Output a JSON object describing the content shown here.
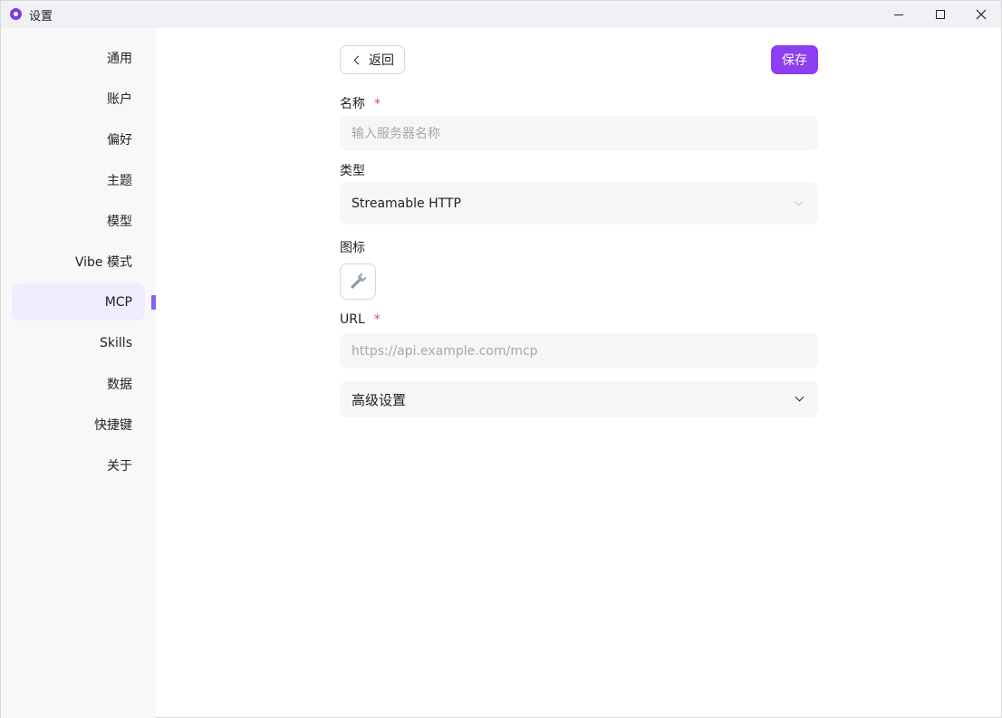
{
  "window": {
    "title": "设置",
    "minimize_icon": "minimize-icon",
    "maximize_icon": "maximize-icon",
    "close_icon": "close-icon"
  },
  "sidebar": {
    "items": [
      {
        "label": "通用"
      },
      {
        "label": "账户"
      },
      {
        "label": "偏好"
      },
      {
        "label": "主题"
      },
      {
        "label": "模型"
      },
      {
        "label": "Vibe 模式"
      },
      {
        "label": "MCP",
        "active": true
      },
      {
        "label": "Skills"
      },
      {
        "label": "数据"
      },
      {
        "label": "快捷键"
      },
      {
        "label": "关于"
      }
    ]
  },
  "toolbar": {
    "back_label": "返回",
    "save_label": "保存"
  },
  "form": {
    "name": {
      "label": "名称",
      "required_mark": "*",
      "placeholder": "输入服务器名称"
    },
    "type": {
      "label": "类型",
      "value": "Streamable HTTP"
    },
    "icon": {
      "label": "图标",
      "icon_name": "wrench-icon"
    },
    "url": {
      "label": "URL",
      "required_mark": "*",
      "placeholder": "https://api.example.com/mcp"
    },
    "advanced": {
      "label": "高级设置"
    }
  },
  "colors": {
    "accent": "#8b3ff0",
    "active_bg": "#efedfb",
    "required": "#e5484d"
  }
}
